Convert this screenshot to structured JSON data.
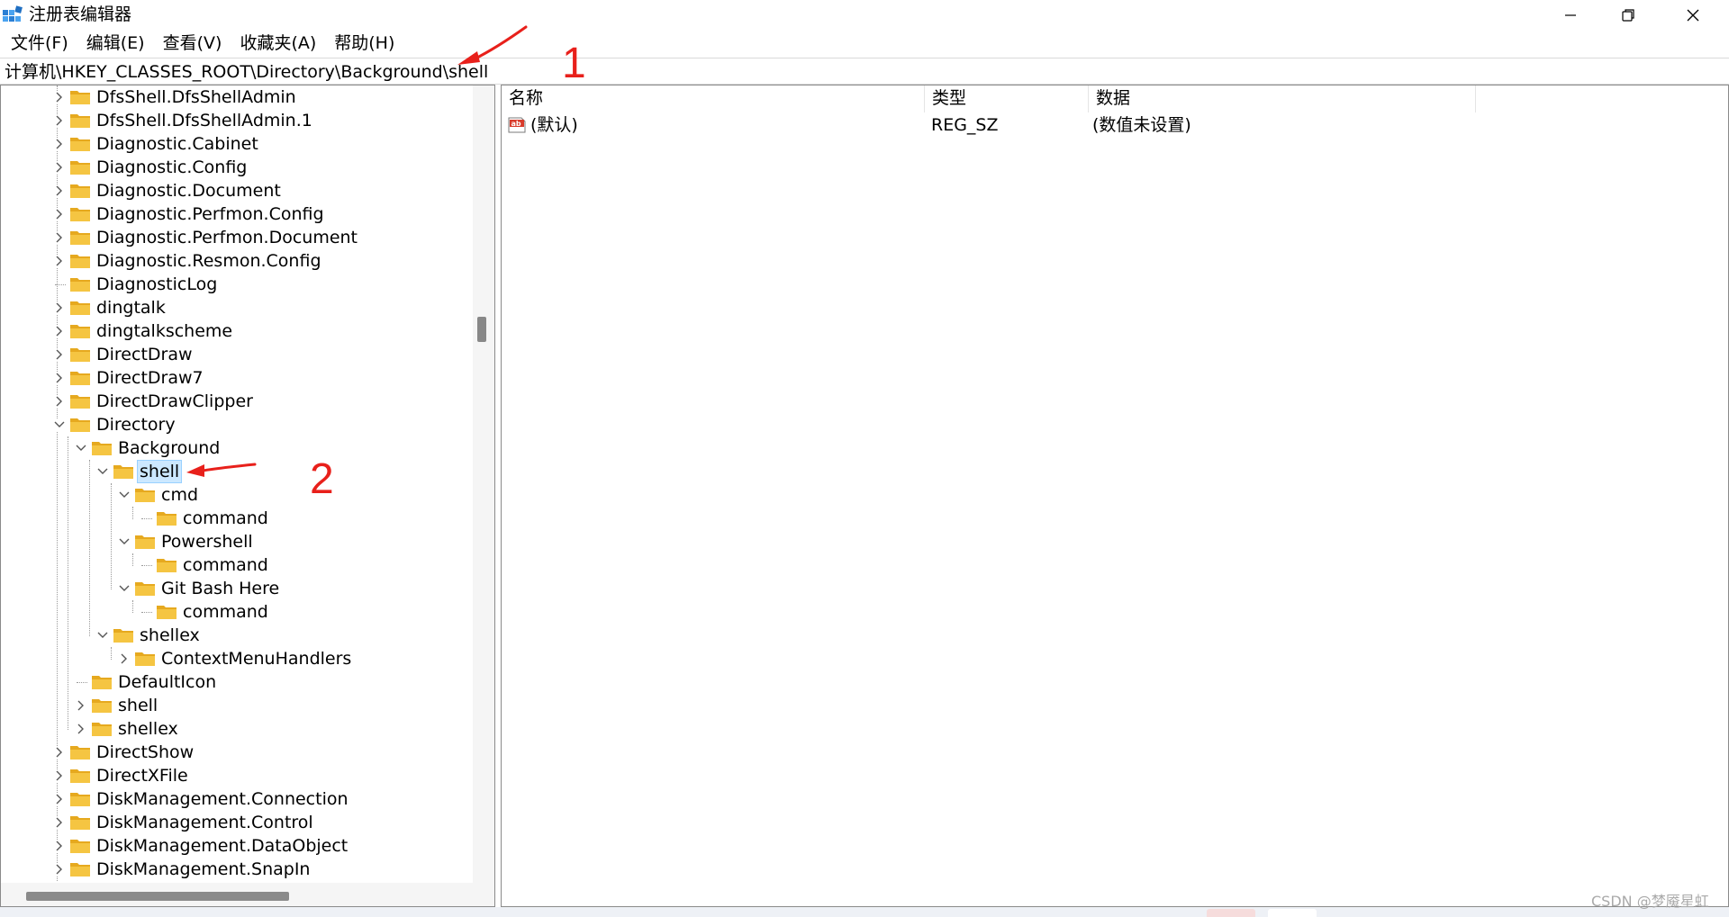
{
  "window": {
    "title": "注册表编辑器",
    "icon": "regedit-icon",
    "controls": [
      "minimize-icon",
      "maximize-icon",
      "close-icon"
    ]
  },
  "menu": [
    {
      "label": "文件(F)"
    },
    {
      "label": "编辑(E)"
    },
    {
      "label": "查看(V)"
    },
    {
      "label": "收藏夹(A)"
    },
    {
      "label": "帮助(H)"
    }
  ],
  "address": "计算机\\HKEY_CLASSES_ROOT\\Directory\\Background\\shell",
  "tree": [
    {
      "label": "DfsShell.DfsShellAdmin",
      "level": 0,
      "expander": "collapsed"
    },
    {
      "label": "DfsShell.DfsShellAdmin.1",
      "level": 0,
      "expander": "collapsed"
    },
    {
      "label": "Diagnostic.Cabinet",
      "level": 0,
      "expander": "collapsed"
    },
    {
      "label": "Diagnostic.Config",
      "level": 0,
      "expander": "collapsed"
    },
    {
      "label": "Diagnostic.Document",
      "level": 0,
      "expander": "collapsed"
    },
    {
      "label": "Diagnostic.Perfmon.Config",
      "level": 0,
      "expander": "collapsed"
    },
    {
      "label": "Diagnostic.Perfmon.Document",
      "level": 0,
      "expander": "collapsed"
    },
    {
      "label": "Diagnostic.Resmon.Config",
      "level": 0,
      "expander": "collapsed"
    },
    {
      "label": "DiagnosticLog",
      "level": 0,
      "expander": "none"
    },
    {
      "label": "dingtalk",
      "level": 0,
      "expander": "collapsed"
    },
    {
      "label": "dingtalkscheme",
      "level": 0,
      "expander": "collapsed"
    },
    {
      "label": "DirectDraw",
      "level": 0,
      "expander": "collapsed"
    },
    {
      "label": "DirectDraw7",
      "level": 0,
      "expander": "collapsed"
    },
    {
      "label": "DirectDrawClipper",
      "level": 0,
      "expander": "collapsed"
    },
    {
      "label": "Directory",
      "level": 0,
      "expander": "expanded"
    },
    {
      "label": "Background",
      "level": 1,
      "expander": "expanded"
    },
    {
      "label": "shell",
      "level": 2,
      "expander": "expanded",
      "selected": true
    },
    {
      "label": "cmd",
      "level": 3,
      "expander": "expanded"
    },
    {
      "label": "command",
      "level": 4,
      "expander": "none"
    },
    {
      "label": "Powershell",
      "level": 3,
      "expander": "expanded"
    },
    {
      "label": "command",
      "level": 4,
      "expander": "none"
    },
    {
      "label": "Git Bash Here",
      "level": 3,
      "expander": "expanded"
    },
    {
      "label": "command",
      "level": 4,
      "expander": "none"
    },
    {
      "label": "shellex",
      "level": 2,
      "expander": "expanded"
    },
    {
      "label": "ContextMenuHandlers",
      "level": 3,
      "expander": "collapsed"
    },
    {
      "label": "DefaultIcon",
      "level": 1,
      "expander": "none"
    },
    {
      "label": "shell",
      "level": 1,
      "expander": "collapsed"
    },
    {
      "label": "shellex",
      "level": 1,
      "expander": "collapsed"
    },
    {
      "label": "DirectShow",
      "level": 0,
      "expander": "collapsed"
    },
    {
      "label": "DirectXFile",
      "level": 0,
      "expander": "collapsed"
    },
    {
      "label": "DiskManagement.Connection",
      "level": 0,
      "expander": "collapsed"
    },
    {
      "label": "DiskManagement.Control",
      "level": 0,
      "expander": "collapsed"
    },
    {
      "label": "DiskManagement.DataObject",
      "level": 0,
      "expander": "collapsed"
    },
    {
      "label": "DiskManagement.SnapIn",
      "level": 0,
      "expander": "collapsed"
    }
  ],
  "list": {
    "columns": {
      "name": "名称",
      "type": "类型",
      "data": "数据"
    },
    "rows": [
      {
        "icon": "string-value-icon",
        "name": "(默认)",
        "type": "REG_SZ",
        "data": "(数值未设置)"
      }
    ]
  },
  "annotations": [
    {
      "number": "1",
      "color": "#e8201b"
    },
    {
      "number": "2",
      "color": "#e8201b"
    }
  ],
  "watermark": "CSDN @梦魇星虹",
  "colors": {
    "folder": "#f5c542",
    "selection": "#cce8ff",
    "annotation": "#e8201b"
  }
}
